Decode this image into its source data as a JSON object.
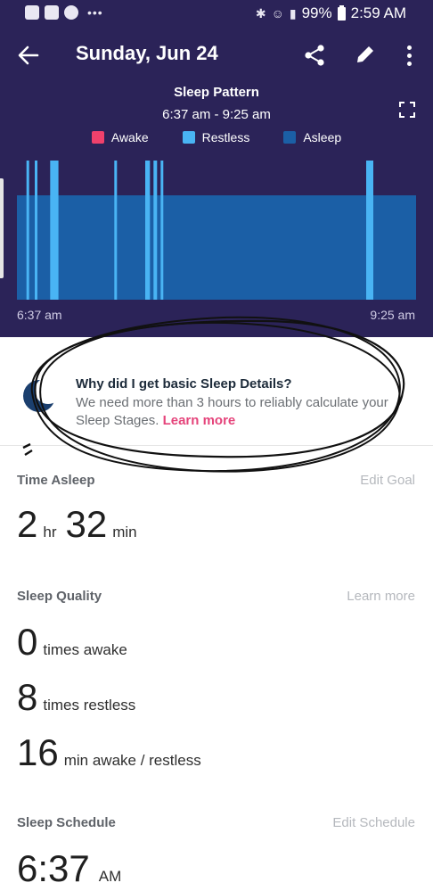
{
  "status_bar": {
    "battery": "99%",
    "time": "2:59 AM",
    "icons": [
      "youtube-icon",
      "gallery-icon",
      "music-icon",
      "more-dots-icon",
      "bluetooth-icon",
      "wifi-call-icon",
      "signal-icon",
      "battery-icon"
    ]
  },
  "header": {
    "title": "Sunday, Jun 24"
  },
  "chart": {
    "title": "Sleep Pattern",
    "range": "6:37 am - 9:25 am",
    "legend": [
      {
        "label": "Awake",
        "color": "#f0416c"
      },
      {
        "label": "Restless",
        "color": "#49b4f4"
      },
      {
        "label": "Asleep",
        "color": "#1b5fa6"
      }
    ],
    "x_start": "6:37 am",
    "x_end": "9:25 am"
  },
  "chart_data": {
    "type": "bar",
    "title": "Sleep Pattern",
    "subtitle": "6:37 am - 9:25 am",
    "x_range": [
      "6:37 am",
      "9:25 am"
    ],
    "total_minutes": 168,
    "series": [
      {
        "name": "Asleep",
        "intervals_min": [
          [
            0,
            168
          ]
        ]
      },
      {
        "name": "Restless",
        "intervals_min": [
          [
            4,
            5
          ],
          [
            7.5,
            8.5
          ],
          [
            14,
            17.5
          ],
          [
            41,
            42
          ],
          [
            54,
            56
          ],
          [
            57.5,
            59
          ],
          [
            60.5,
            61.5
          ],
          [
            147,
            150
          ]
        ]
      },
      {
        "name": "Awake",
        "intervals_min": []
      }
    ]
  },
  "info": {
    "title": "Why did I get basic Sleep Details?",
    "text": "We need more than 3 hours to reliably calculate your Sleep Stages.",
    "link": "Learn more"
  },
  "time_asleep": {
    "label": "Time Asleep",
    "action": "Edit Goal",
    "hours": "2",
    "hours_unit": "hr",
    "minutes": "32",
    "minutes_unit": "min"
  },
  "sleep_quality": {
    "label": "Sleep Quality",
    "action": "Learn more",
    "awake_value": "0",
    "awake_unit": "times awake",
    "restless_value": "8",
    "restless_unit": "times restless",
    "minutes_value": "16",
    "minutes_unit": "min awake / restless"
  },
  "sleep_schedule": {
    "label": "Sleep Schedule",
    "action": "Edit Schedule",
    "time": "6:37",
    "period": "AM"
  }
}
